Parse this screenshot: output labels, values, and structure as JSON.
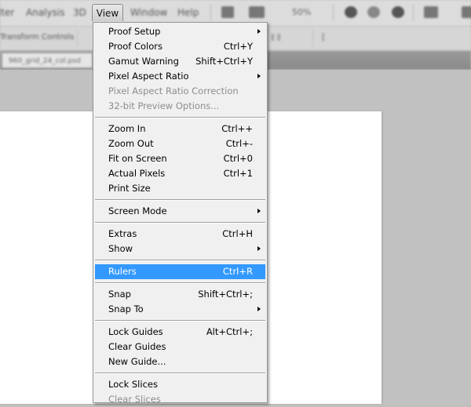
{
  "menubar": {
    "items": [
      "lter",
      "Analysis",
      "3D",
      "View",
      "Window",
      "Help"
    ],
    "active": "View",
    "zoom_level": "50%"
  },
  "options_bar": {
    "label": "Transform Controls"
  },
  "document_tab": {
    "label": "960_grid_24_col.psd"
  },
  "view_menu": {
    "items": [
      {
        "label": "Proof Setup",
        "shortcut": "",
        "submenu": true,
        "disabled": false
      },
      {
        "label": "Proof Colors",
        "shortcut": "Ctrl+Y",
        "submenu": false,
        "disabled": false
      },
      {
        "label": "Gamut Warning",
        "shortcut": "Shift+Ctrl+Y",
        "submenu": false,
        "disabled": false
      },
      {
        "label": "Pixel Aspect Ratio",
        "shortcut": "",
        "submenu": true,
        "disabled": false
      },
      {
        "label": "Pixel Aspect Ratio Correction",
        "shortcut": "",
        "submenu": false,
        "disabled": true
      },
      {
        "label": "32-bit Preview Options...",
        "shortcut": "",
        "submenu": false,
        "disabled": true
      },
      {
        "label": "Zoom In",
        "shortcut": "Ctrl++",
        "submenu": false,
        "disabled": false
      },
      {
        "label": "Zoom Out",
        "shortcut": "Ctrl+-",
        "submenu": false,
        "disabled": false
      },
      {
        "label": "Fit on Screen",
        "shortcut": "Ctrl+0",
        "submenu": false,
        "disabled": false
      },
      {
        "label": "Actual Pixels",
        "shortcut": "Ctrl+1",
        "submenu": false,
        "disabled": false
      },
      {
        "label": "Print Size",
        "shortcut": "",
        "submenu": false,
        "disabled": false
      },
      {
        "label": "Screen Mode",
        "shortcut": "",
        "submenu": true,
        "disabled": false
      },
      {
        "label": "Extras",
        "shortcut": "Ctrl+H",
        "submenu": false,
        "disabled": false
      },
      {
        "label": "Show",
        "shortcut": "",
        "submenu": true,
        "disabled": false
      },
      {
        "label": "Rulers",
        "shortcut": "Ctrl+R",
        "submenu": false,
        "disabled": false,
        "highlighted": true
      },
      {
        "label": "Snap",
        "shortcut": "Shift+Ctrl+;",
        "submenu": false,
        "disabled": false
      },
      {
        "label": "Snap To",
        "shortcut": "",
        "submenu": true,
        "disabled": false
      },
      {
        "label": "Lock Guides",
        "shortcut": "Alt+Ctrl+;",
        "submenu": false,
        "disabled": false
      },
      {
        "label": "Clear Guides",
        "shortcut": "",
        "submenu": false,
        "disabled": false
      },
      {
        "label": "New Guide...",
        "shortcut": "",
        "submenu": false,
        "disabled": false
      },
      {
        "label": "Lock Slices",
        "shortcut": "",
        "submenu": false,
        "disabled": false
      },
      {
        "label": "Clear Slices",
        "shortcut": "",
        "submenu": false,
        "disabled": true
      }
    ],
    "groups": [
      [
        0,
        1,
        2,
        3,
        4,
        5
      ],
      [
        6,
        7,
        8,
        9,
        10
      ],
      [
        11
      ],
      [
        12,
        13
      ],
      [
        14
      ],
      [
        15,
        16
      ],
      [
        17,
        18,
        19
      ],
      [
        20,
        21
      ]
    ]
  },
  "colors": {
    "highlight": "#3399ff",
    "menu_bg": "#f0f0f0",
    "disabled_text": "#8d8d8d"
  }
}
